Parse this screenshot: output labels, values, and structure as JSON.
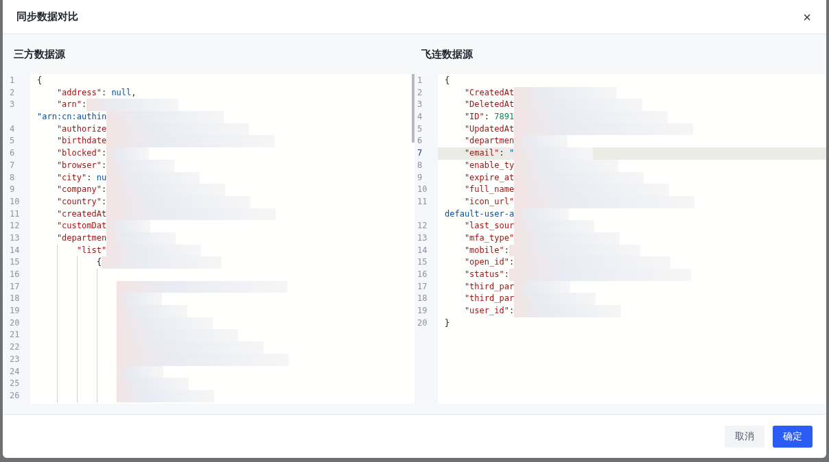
{
  "dialog": {
    "title": "同步数据对比",
    "close": "×"
  },
  "panels": [
    {
      "title": "三方数据源",
      "lines": [
        {
          "number": "1",
          "selected": false,
          "redacted": false,
          "parts": [
            {
              "kind": "punct",
              "text": "{"
            }
          ]
        },
        {
          "number": "2",
          "selected": false,
          "redacted": false,
          "parts": [
            {
              "kind": "key",
              "text": "    \"address\""
            },
            {
              "kind": "punct",
              "text": ": "
            },
            {
              "kind": "literal",
              "text": "null"
            },
            {
              "kind": "punct",
              "text": ","
            }
          ]
        },
        {
          "number": "3",
          "selected": false,
          "redacted": true,
          "parts": [
            {
              "kind": "key",
              "text": "    \"arn\""
            },
            {
              "kind": "punct",
              "text": ":"
            }
          ]
        },
        {
          "selected": false,
          "redacted": true,
          "parts": [
            {
              "kind": "string",
              "text": "\"arn:cn:authin"
            }
          ]
        },
        {
          "number": "4",
          "selected": false,
          "redacted": true,
          "parts": [
            {
              "kind": "key",
              "text": "    \"authorize"
            }
          ]
        },
        {
          "number": "5",
          "selected": false,
          "redacted": true,
          "parts": [
            {
              "kind": "key",
              "text": "    \"birthdate"
            }
          ]
        },
        {
          "number": "6",
          "selected": false,
          "redacted": true,
          "parts": [
            {
              "kind": "key",
              "text": "    \"blocked\""
            },
            {
              "kind": "punct",
              "text": ":"
            }
          ]
        },
        {
          "number": "7",
          "selected": false,
          "redacted": true,
          "parts": [
            {
              "kind": "key",
              "text": "    \"browser\""
            },
            {
              "kind": "punct",
              "text": ":"
            }
          ]
        },
        {
          "number": "8",
          "selected": false,
          "redacted": true,
          "parts": [
            {
              "kind": "key",
              "text": "    \"city\""
            },
            {
              "kind": "punct",
              "text": ": "
            },
            {
              "kind": "literal",
              "text": "nu"
            }
          ]
        },
        {
          "number": "9",
          "selected": false,
          "redacted": true,
          "parts": [
            {
              "kind": "key",
              "text": "    \"company\""
            },
            {
              "kind": "punct",
              "text": ":"
            }
          ]
        },
        {
          "number": "10",
          "selected": false,
          "redacted": true,
          "parts": [
            {
              "kind": "key",
              "text": "    \"country\""
            },
            {
              "kind": "punct",
              "text": ":"
            }
          ]
        },
        {
          "number": "11",
          "selected": false,
          "redacted": true,
          "parts": [
            {
              "kind": "key",
              "text": "    \"createdAt"
            }
          ]
        },
        {
          "number": "12",
          "selected": false,
          "redacted": true,
          "parts": [
            {
              "kind": "key",
              "text": "    \"customDat"
            }
          ]
        },
        {
          "number": "13",
          "selected": false,
          "redacted": true,
          "parts": [
            {
              "kind": "key",
              "text": "    \"departmen"
            }
          ]
        },
        {
          "number": "14",
          "selected": false,
          "redacted": true,
          "parts": [
            {
              "kind": "key",
              "text": "        \"list\""
            }
          ]
        },
        {
          "number": "15",
          "selected": false,
          "redacted": true,
          "parts": [
            {
              "kind": "punct",
              "text": "            {"
            }
          ]
        },
        {
          "number": "16",
          "selected": false,
          "redacted": false
        },
        {
          "number": "17",
          "selected": false,
          "redacted": true
        },
        {
          "number": "18",
          "selected": false,
          "redacted": true
        },
        {
          "number": "19",
          "selected": false,
          "redacted": true
        },
        {
          "number": "20",
          "selected": false,
          "redacted": true
        },
        {
          "number": "21",
          "selected": false,
          "redacted": true
        },
        {
          "number": "22",
          "selected": false,
          "redacted": true
        },
        {
          "number": "23",
          "selected": false,
          "redacted": true
        },
        {
          "number": "24",
          "selected": false,
          "redacted": true
        },
        {
          "number": "25",
          "selected": false,
          "redacted": true
        },
        {
          "number": "26",
          "selected": false,
          "redacted": true
        }
      ]
    },
    {
      "title": "飞连数据源",
      "lines": [
        {
          "number": "1",
          "selected": false,
          "redacted": false,
          "parts": [
            {
              "kind": "punct",
              "text": "{"
            }
          ]
        },
        {
          "number": "2",
          "selected": false,
          "redacted": true,
          "parts": [
            {
              "kind": "key",
              "text": "    \"CreatedAt"
            }
          ]
        },
        {
          "number": "3",
          "selected": false,
          "redacted": true,
          "parts": [
            {
              "kind": "key",
              "text": "    \"DeletedAt"
            }
          ]
        },
        {
          "number": "4",
          "selected": false,
          "redacted": true,
          "parts": [
            {
              "kind": "key",
              "text": "    \"ID\""
            },
            {
              "kind": "punct",
              "text": ": "
            },
            {
              "kind": "number",
              "text": "7891"
            }
          ]
        },
        {
          "number": "5",
          "selected": false,
          "redacted": true,
          "parts": [
            {
              "kind": "key",
              "text": "    \"UpdatedAt"
            }
          ]
        },
        {
          "number": "6",
          "selected": false,
          "redacted": true,
          "parts": [
            {
              "kind": "key",
              "text": "    \"departmen"
            }
          ]
        },
        {
          "number": "7",
          "selected": true,
          "redacted": true,
          "parts": [
            {
              "kind": "key",
              "text": "    \"email\""
            },
            {
              "kind": "punct",
              "text": ": "
            },
            {
              "kind": "string",
              "text": "\""
            }
          ]
        },
        {
          "number": "8",
          "selected": false,
          "redacted": true,
          "parts": [
            {
              "kind": "key",
              "text": "    \"enable_ty"
            }
          ]
        },
        {
          "number": "9",
          "selected": false,
          "redacted": true,
          "parts": [
            {
              "kind": "key",
              "text": "    \"expire_at"
            }
          ]
        },
        {
          "number": "10",
          "selected": false,
          "redacted": true,
          "parts": [
            {
              "kind": "key",
              "text": "    \"full_name"
            }
          ]
        },
        {
          "number": "11",
          "selected": false,
          "redacted": true,
          "parts": [
            {
              "kind": "key",
              "text": "    \"icon_url\""
            }
          ]
        },
        {
          "selected": false,
          "redacted": true,
          "parts": [
            {
              "kind": "string",
              "text": "default-user-a"
            }
          ]
        },
        {
          "number": "12",
          "selected": false,
          "redacted": true,
          "parts": [
            {
              "kind": "key",
              "text": "    \"last_sour"
            }
          ]
        },
        {
          "number": "13",
          "selected": false,
          "redacted": true,
          "parts": [
            {
              "kind": "key",
              "text": "    \"mfa_type\""
            }
          ]
        },
        {
          "number": "14",
          "selected": false,
          "redacted": true,
          "parts": [
            {
              "kind": "key",
              "text": "    \"mobile\""
            },
            {
              "kind": "punct",
              "text": ":"
            }
          ]
        },
        {
          "number": "15",
          "selected": false,
          "redacted": true,
          "parts": [
            {
              "kind": "key",
              "text": "    \"open_id\""
            },
            {
              "kind": "punct",
              "text": ":"
            }
          ]
        },
        {
          "number": "16",
          "selected": false,
          "redacted": true,
          "parts": [
            {
              "kind": "key",
              "text": "    \"status\""
            },
            {
              "kind": "punct",
              "text": ":"
            }
          ]
        },
        {
          "number": "17",
          "selected": false,
          "redacted": true,
          "parts": [
            {
              "kind": "key",
              "text": "    \"third_par"
            }
          ]
        },
        {
          "number": "18",
          "selected": false,
          "redacted": true,
          "parts": [
            {
              "kind": "key",
              "text": "    \"third_par"
            }
          ]
        },
        {
          "number": "19",
          "selected": false,
          "redacted": true,
          "parts": [
            {
              "kind": "key",
              "text": "    \"user_id\""
            },
            {
              "kind": "punct",
              "text": ":"
            }
          ]
        },
        {
          "number": "20",
          "selected": false,
          "redacted": false,
          "parts": [
            {
              "kind": "punct",
              "text": "}"
            }
          ]
        }
      ]
    }
  ],
  "buttons": [
    {
      "label": "取消",
      "kind": "secondary"
    },
    {
      "label": "确定",
      "kind": "primary"
    }
  ]
}
